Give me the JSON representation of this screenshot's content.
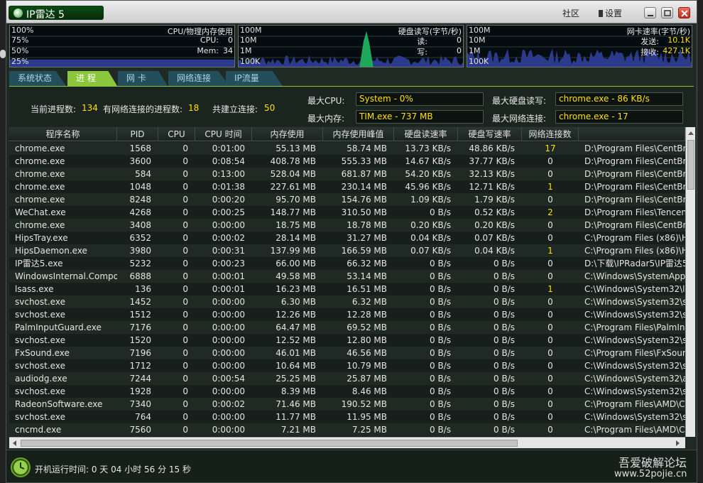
{
  "window": {
    "title": "IP雷达 5",
    "links": {
      "community": "社区",
      "settings": "设置"
    }
  },
  "graphs": {
    "cpu": {
      "title": "CPU/物理内存使用",
      "scale": [
        "100%",
        "75%",
        "50%",
        "25%"
      ],
      "cpu_label": "CPU:",
      "cpu_value": "0",
      "mem_label": "Mem:",
      "mem_value": "34",
      "mem_percent": 34
    },
    "disk": {
      "title": "硬盘读写(字节/秒)",
      "scale": [
        "100M",
        "10M",
        "1M",
        "100K"
      ],
      "read_label": "读:",
      "read_value": "0",
      "write_label": "写:",
      "write_value": "0"
    },
    "net": {
      "title": "网卡速率(字节/秒)",
      "scale": [
        "100M",
        "10M",
        "1M",
        "100K"
      ],
      "send_label": "发送:",
      "send_value": "10.1K",
      "recv_label": "接收:",
      "recv_value": "427.1K"
    }
  },
  "tabs": [
    {
      "label": "系统状态",
      "active": false
    },
    {
      "label": "进 程",
      "active": true
    },
    {
      "label": "网 卡",
      "active": false
    },
    {
      "label": "网络连接",
      "active": false
    },
    {
      "label": "IP流量",
      "active": false
    }
  ],
  "stats": {
    "process_count_label": "当前进程数:",
    "process_count": "134",
    "net_process_label": "有网络连接的进程数:",
    "net_process_count": "18",
    "connections_label": "共建立连接:",
    "connections": "50",
    "max_cpu_label": "最大CPU:",
    "max_cpu": "System - 0%",
    "max_mem_label": "最大内存:",
    "max_mem": "TIM.exe - 737 MB",
    "max_disk_label": "最大硬盘读写:",
    "max_disk": "chrome.exe - 86 KB/s",
    "max_net_label": "最大网络连接:",
    "max_net": "chrome.exe - 17"
  },
  "table": {
    "columns": [
      "程序名称",
      "PID",
      "CPU",
      "CPU 时间",
      "内存使用",
      "内存使用峰值",
      "硬盘读速率",
      "硬盘写速率",
      "网络连接数",
      ""
    ],
    "rows": [
      [
        "chrome.exe",
        "1568",
        "0",
        "0:01:00",
        "55.13 MB",
        "58.74 MB",
        "13.73 KB/s",
        "48.86 KB/s",
        "17",
        "D:\\Program Files\\CentBrow"
      ],
      [
        "chrome.exe",
        "3600",
        "0",
        "0:08:54",
        "408.78 MB",
        "555.33 MB",
        "14.67 KB/s",
        "37.77 KB/s",
        "0",
        "D:\\Program Files\\CentBrow"
      ],
      [
        "chrome.exe",
        "584",
        "0",
        "0:13:00",
        "528.04 MB",
        "681.87 MB",
        "54.20 KB/s",
        "32.13 KB/s",
        "0",
        "D:\\Program Files\\CentBrow"
      ],
      [
        "chrome.exe",
        "1048",
        "0",
        "0:01:38",
        "227.61 MB",
        "230.14 MB",
        "45.96 KB/s",
        "12.71 KB/s",
        "1",
        "D:\\Program Files\\CentBrow"
      ],
      [
        "chrome.exe",
        "8248",
        "0",
        "0:00:20",
        "95.70 MB",
        "154.76 MB",
        "1.09 KB/s",
        "1.79 KB/s",
        "0",
        "D:\\Program Files\\CentBrow"
      ],
      [
        "WeChat.exe",
        "4268",
        "0",
        "0:00:25",
        "148.77 MB",
        "310.50 MB",
        "0 B/s",
        "0.52 KB/s",
        "2",
        "D:\\Program Files\\Tencent\\"
      ],
      [
        "chrome.exe",
        "3408",
        "0",
        "0:00:00",
        "18.75 MB",
        "18.78 MB",
        "0.20 KB/s",
        "0.20 KB/s",
        "0",
        "D:\\Program Files\\CentBrow"
      ],
      [
        "HipsTray.exe",
        "6352",
        "0",
        "0:00:02",
        "28.14 MB",
        "31.27 MB",
        "0.04 KB/s",
        "0.07 KB/s",
        "0",
        "C:\\Program Files (x86)\\Huo"
      ],
      [
        "HipsDaemon.exe",
        "3980",
        "0",
        "0:00:31",
        "137.99 MB",
        "166.59 MB",
        "0.07 KB/s",
        "0.04 KB/s",
        "1",
        "C:\\Program Files (x86)\\Huo"
      ],
      [
        "IP雷达5.exe",
        "5232",
        "0",
        "0:00:23",
        "66.00 MB",
        "66.32 MB",
        "0 B/s",
        "0 B/s",
        "0",
        "D:\\下载\\IPRadar5\\IP雷达5."
      ],
      [
        "WindowsInternal.Compo...",
        "6888",
        "0",
        "0:00:01",
        "49.58 MB",
        "53.14 MB",
        "0 B/s",
        "0 B/s",
        "0",
        "C:\\Windows\\SystemApps\\"
      ],
      [
        "lsass.exe",
        "136",
        "0",
        "0:00:01",
        "16.23 MB",
        "16.51 MB",
        "0 B/s",
        "0 B/s",
        "1",
        "C:\\Windows\\System32\\lsas"
      ],
      [
        "svchost.exe",
        "1452",
        "0",
        "0:00:00",
        "6.30 MB",
        "6.32 MB",
        "0 B/s",
        "0 B/s",
        "0",
        "C:\\Windows\\System32\\svc"
      ],
      [
        "svchost.exe",
        "1512",
        "0",
        "0:00:00",
        "12.26 MB",
        "12.28 MB",
        "0 B/s",
        "0 B/s",
        "0",
        "C:\\Windows\\System32\\svc"
      ],
      [
        "PalmInputGuard.exe",
        "7176",
        "0",
        "0:00:00",
        "64.47 MB",
        "69.52 MB",
        "0 B/s",
        "0 B/s",
        "0",
        "C:\\Program Files\\PalmInput"
      ],
      [
        "svchost.exe",
        "1520",
        "0",
        "0:00:00",
        "12.52 MB",
        "12.80 MB",
        "0 B/s",
        "0 B/s",
        "0",
        "C:\\Windows\\System32\\svc"
      ],
      [
        "FxSound.exe",
        "7196",
        "0",
        "0:00:00",
        "46.01 MB",
        "46.56 MB",
        "0 B/s",
        "0 B/s",
        "0",
        "C:\\Program Files\\FxSound L"
      ],
      [
        "svchost.exe",
        "1712",
        "0",
        "0:00:00",
        "10.64 MB",
        "10.79 MB",
        "0 B/s",
        "0 B/s",
        "0",
        "C:\\Windows\\System32\\svc"
      ],
      [
        "audiodg.exe",
        "7244",
        "0",
        "0:00:54",
        "25.25 MB",
        "25.87 MB",
        "0 B/s",
        "0 B/s",
        "0",
        "C:\\Windows\\System32\\aud"
      ],
      [
        "svchost.exe",
        "1928",
        "0",
        "0:00:00",
        "8.39 MB",
        "8.46 MB",
        "0 B/s",
        "0 B/s",
        "0",
        "C:\\Windows\\System32\\svc"
      ],
      [
        "RadeonSoftware.exe",
        "7340",
        "0",
        "0:00:02",
        "71.46 MB",
        "190.52 MB",
        "0 B/s",
        "0 B/s",
        "0",
        "C:\\Program Files\\AMD\\CNe"
      ],
      [
        "svchost.exe",
        "764",
        "0",
        "0:00:00",
        "11.77 MB",
        "11.95 MB",
        "0 B/s",
        "0 B/s",
        "0",
        "C:\\Windows\\System32\\svc"
      ],
      [
        "cncmd.exe",
        "7560",
        "0",
        "0:00:00",
        "7.21 MB",
        "7.25 MB",
        "0 B/s",
        "0 B/s",
        "0",
        "C:\\Program Files\\AMD\\CNe"
      ]
    ]
  },
  "status": {
    "uptime": "开机运行时间:  0 天 04 小时 56 分 15 秒"
  },
  "watermark": {
    "line1": "吾爱破解论坛",
    "line2": "www.52pojie.cn"
  },
  "colors": {
    "accent": "#8cc63c",
    "highlight": "#ffe000",
    "graph_fill": "#2b3a8a",
    "graph_spike": "#1fa85a"
  },
  "icons": {
    "app": "ip-radar-logo-icon",
    "settings": "settings-icon",
    "uptime": "clock-icon"
  }
}
